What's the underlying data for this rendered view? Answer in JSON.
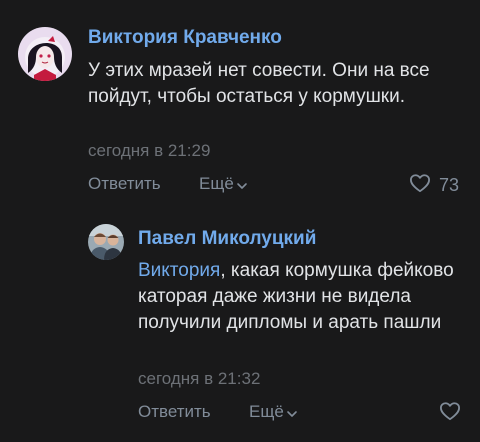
{
  "comments": [
    {
      "author": "Виктория Кравченко",
      "text": "У этих мразей нет совести. Они на все пойдут, чтобы остаться у кормушки.",
      "time": "сегодня в 21:29",
      "reply_label": "Ответить",
      "more_label": "Ещё",
      "likes": "73"
    },
    {
      "author": "Павел Миколуцкий",
      "mention": "Виктория",
      "text": ", какая кормушка фейково каторая даже жизни не видела получили дипломы и арать пашли",
      "time": "сегодня в 21:32",
      "reply_label": "Ответить",
      "more_label": "Ещё",
      "likes": ""
    }
  ],
  "colors": {
    "background": "#19191a",
    "link": "#71aaeb",
    "text": "#e1e3e6",
    "secondary": "#818c99",
    "time": "#6d7177"
  },
  "icons": [
    "avatar-image",
    "chevron-down-icon",
    "heart-icon"
  ]
}
